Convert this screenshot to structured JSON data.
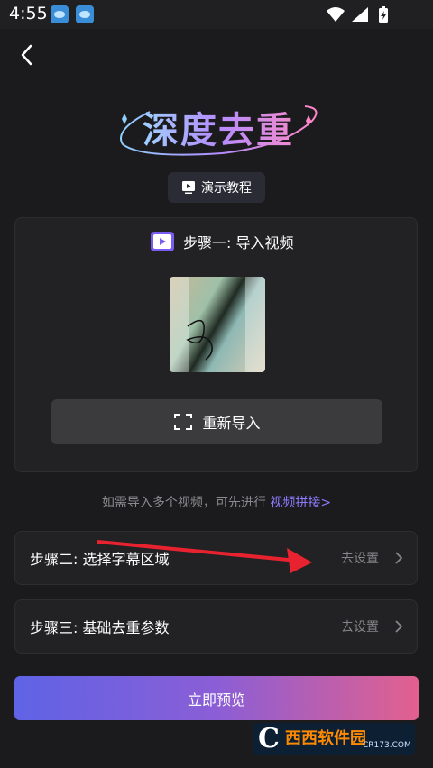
{
  "status_bar": {
    "time": "4:55"
  },
  "hero": {
    "title": "深度去重"
  },
  "tutorial": {
    "label": "演示教程"
  },
  "step1": {
    "title": "步骤一: 导入视频",
    "reimport_label": "重新导入"
  },
  "hint": {
    "text": "如需导入多个视频，可先进行 ",
    "link": "视频拼接>"
  },
  "step2": {
    "label": "步骤二: 选择字幕区域",
    "action": "去设置"
  },
  "step3": {
    "label": "步骤三: 基础去重参数",
    "action": "去设置"
  },
  "preview": {
    "label": "立即预览"
  },
  "watermark": {
    "main": "西西软件园",
    "sub": "CR173.COM"
  },
  "colors": {
    "background": "#1b1b1d",
    "card": "#222224",
    "accent_link": "#8e7bff",
    "gradient_start": "#5f63e6",
    "gradient_end": "#e2608e",
    "annotation_arrow": "#e8232f"
  }
}
